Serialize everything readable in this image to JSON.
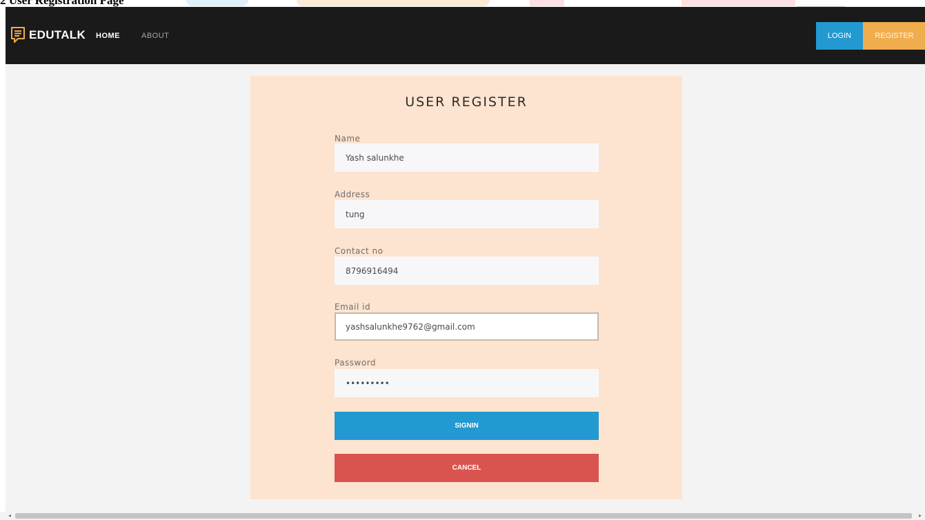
{
  "caption": "2 User Registration Page",
  "navbar": {
    "brand": "EDUTALK",
    "links": [
      "HOME",
      "ABOUT"
    ],
    "login_label": "LOGIN",
    "register_label": "REGISTER"
  },
  "form": {
    "title": "USER REGISTER",
    "fields": [
      {
        "label": "Name",
        "value": "Yash salunkhe"
      },
      {
        "label": "Address",
        "value": "tung"
      },
      {
        "label": "Contact no",
        "value": "8796916494"
      },
      {
        "label": "Email id",
        "value": "yashsalunkhe9762@gmail.com"
      },
      {
        "label": "Password",
        "value": "•••••••••"
      }
    ],
    "signin_label": "SIGNIN",
    "cancel_label": "CANCEL"
  },
  "colors": {
    "navbar_bg": "#1a1a1a",
    "card_bg": "#fde4d0",
    "login_blue": "#2399d1",
    "register_orange": "#f0ad4e",
    "cancel_red": "#d9534f"
  },
  "icons": {
    "brand": "chat-message-icon",
    "scroll_left": "scroll-left-arrow-icon",
    "scroll_right": "scroll-right-arrow-icon"
  }
}
